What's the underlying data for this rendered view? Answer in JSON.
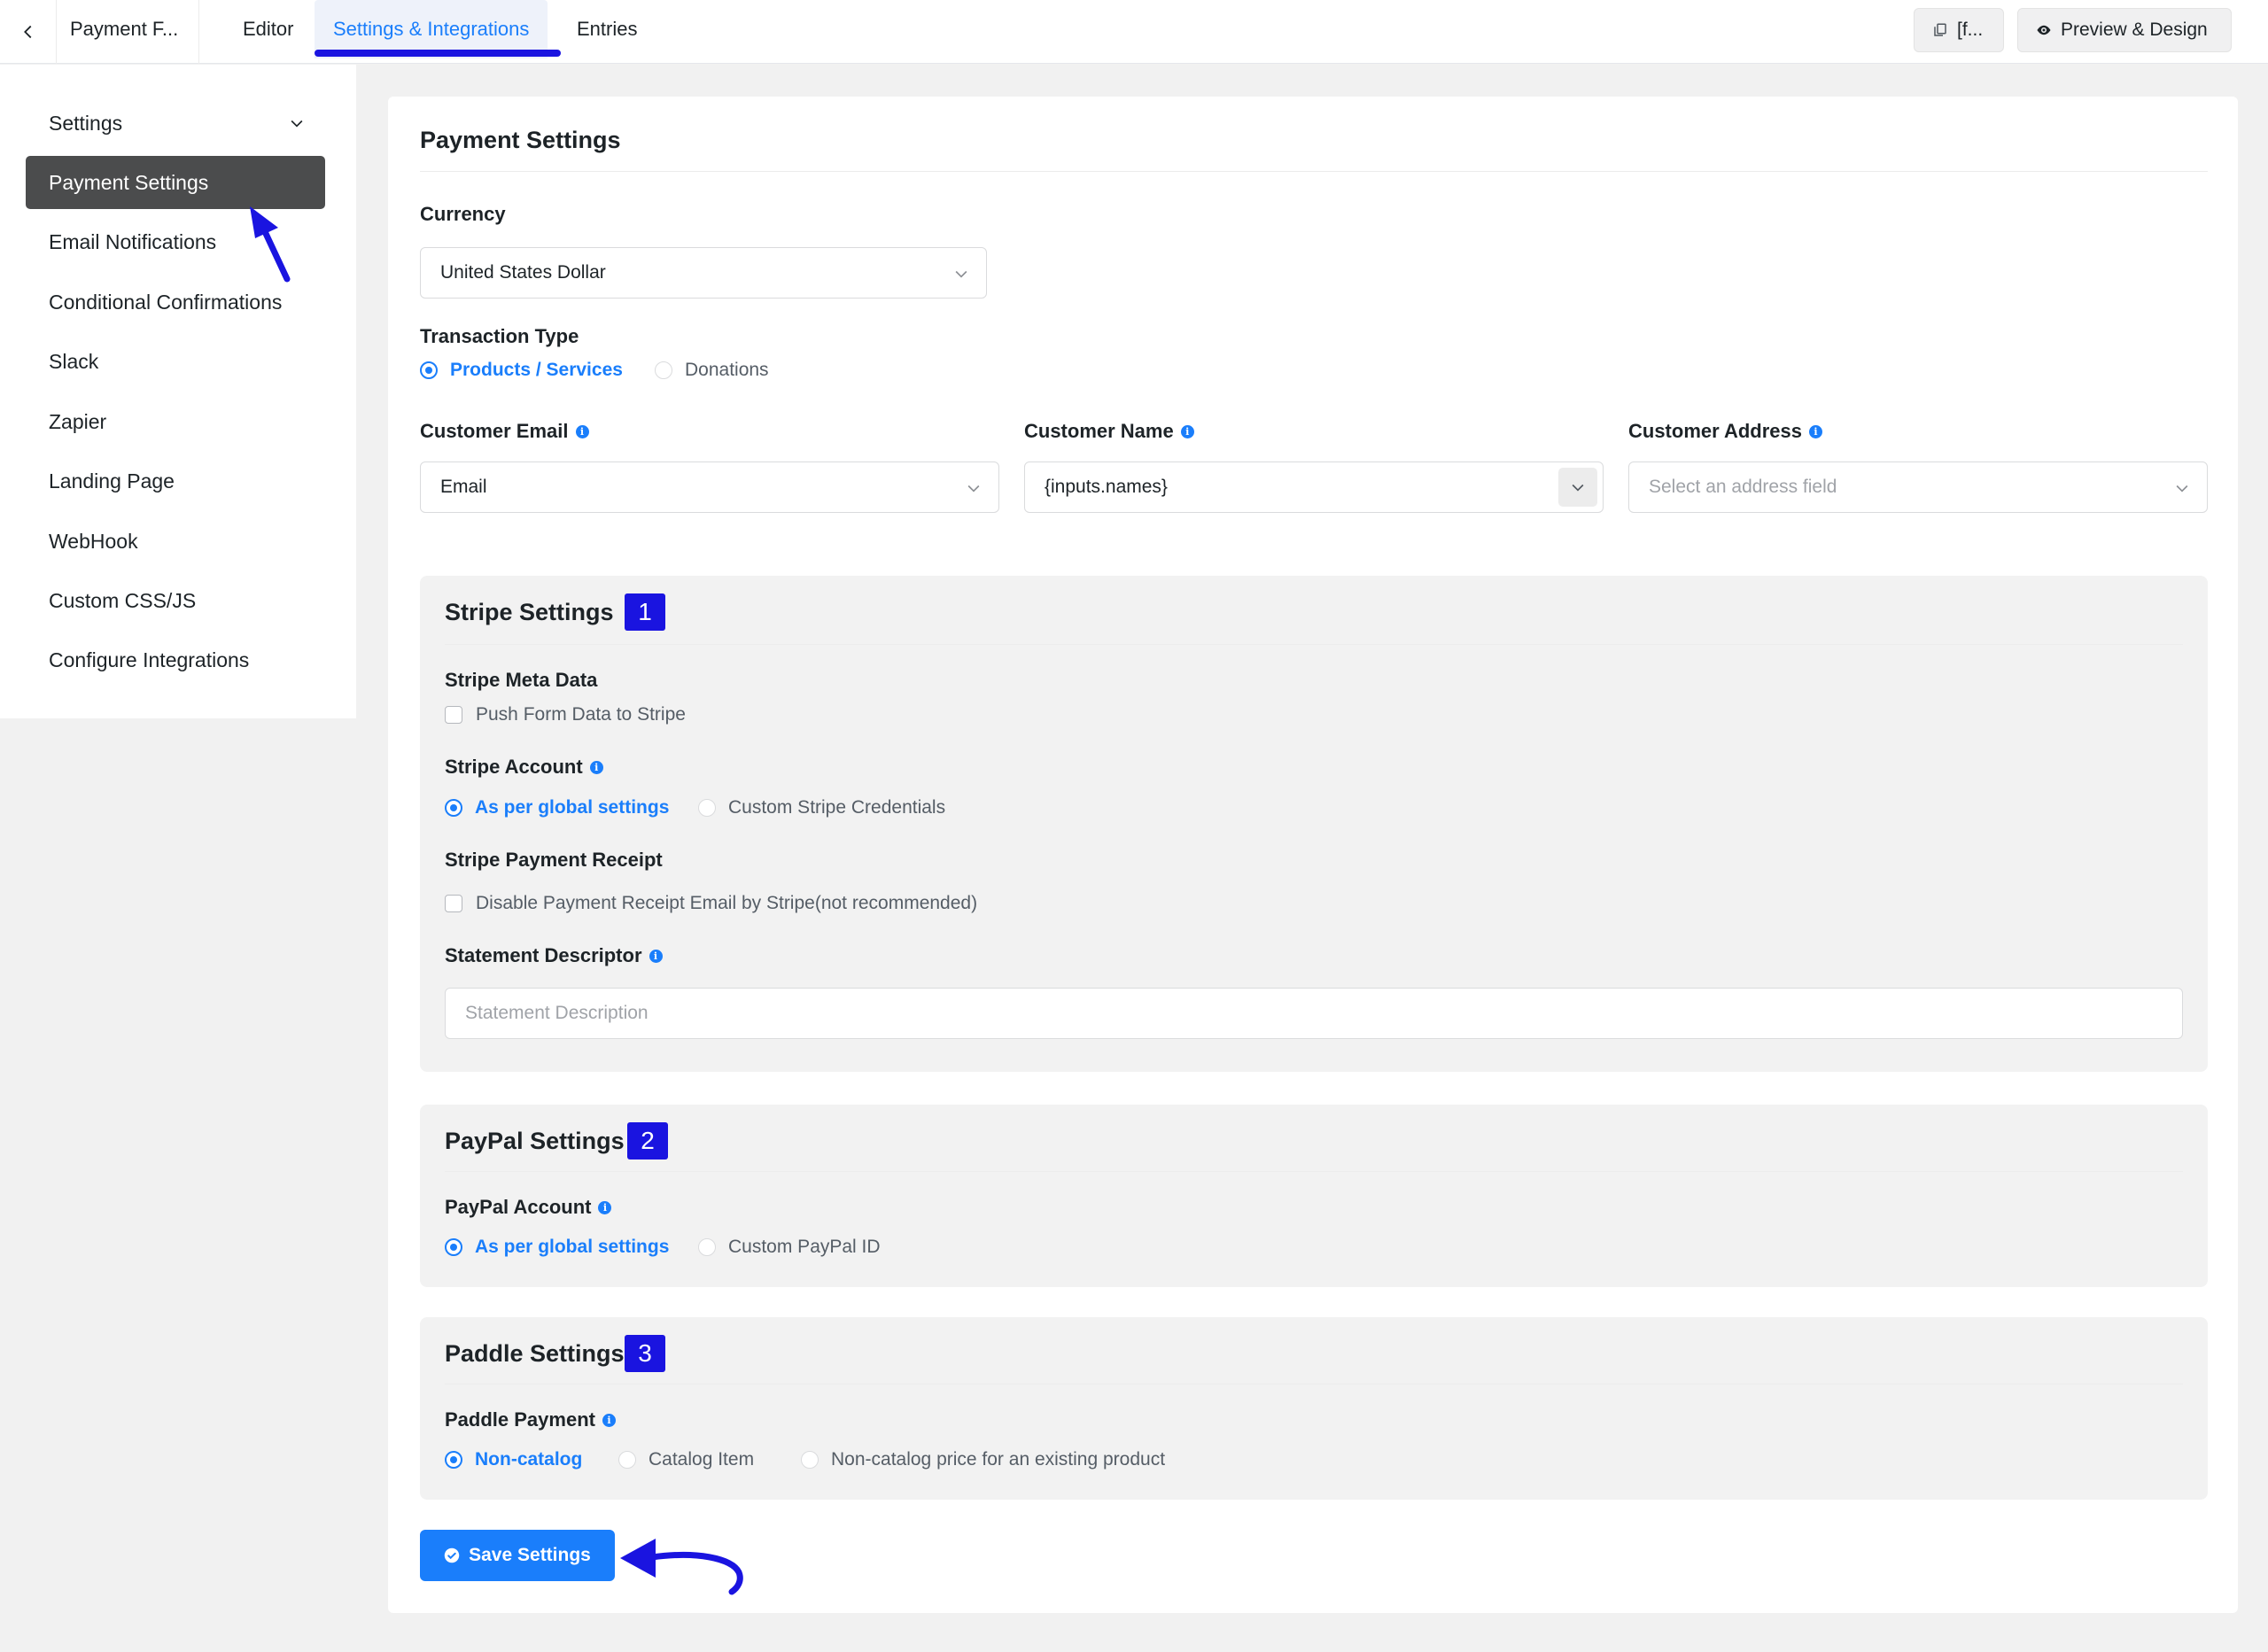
{
  "header": {
    "form_title": "Payment F...",
    "tabs": [
      {
        "label": "Editor"
      },
      {
        "label": "Settings & Integrations"
      },
      {
        "label": "Entries"
      }
    ],
    "shortcode_label": "[f...",
    "preview_label": "Preview & Design"
  },
  "sidebar": {
    "items": [
      {
        "label": "Settings"
      },
      {
        "label": "Payment Settings"
      },
      {
        "label": "Email Notifications"
      },
      {
        "label": "Conditional Confirmations"
      },
      {
        "label": "Slack"
      },
      {
        "label": "Zapier"
      },
      {
        "label": "Landing Page"
      },
      {
        "label": "WebHook"
      },
      {
        "label": "Custom CSS/JS"
      },
      {
        "label": "Configure Integrations"
      }
    ]
  },
  "main": {
    "title": "Payment Settings",
    "currency": {
      "label": "Currency",
      "value": "United States Dollar"
    },
    "transaction_type": {
      "label": "Transaction Type",
      "options": [
        "Products / Services",
        "Donations"
      ]
    },
    "customer_email": {
      "label": "Customer Email",
      "value": "Email"
    },
    "customer_name": {
      "label": "Customer Name",
      "value": "{inputs.names}"
    },
    "customer_address": {
      "label": "Customer Address",
      "placeholder": "Select an address field"
    },
    "stripe": {
      "title": "Stripe Settings",
      "badge": "1",
      "meta_label": "Stripe Meta Data",
      "meta_checkbox": "Push Form Data to Stripe",
      "account_label": "Stripe Account",
      "account_options": [
        "As per global settings",
        "Custom Stripe Credentials"
      ],
      "receipt_label": "Stripe Payment Receipt",
      "receipt_checkbox": "Disable Payment Receipt Email by Stripe(not recommended)",
      "descriptor_label": "Statement Descriptor",
      "descriptor_placeholder": "Statement Description"
    },
    "paypal": {
      "title": "PayPal Settings",
      "badge": "2",
      "account_label": "PayPal Account",
      "account_options": [
        "As per global settings",
        "Custom PayPal ID"
      ]
    },
    "paddle": {
      "title": "Paddle Settings",
      "badge": "3",
      "payment_label": "Paddle Payment",
      "payment_options": [
        "Non-catalog",
        "Catalog Item",
        "Non-catalog price for an existing product"
      ]
    },
    "save_label": "Save Settings"
  },
  "colors": {
    "primary": "#1a7efb",
    "annotation": "#1a14e0",
    "sidebar_active": "#4b4c4d"
  }
}
